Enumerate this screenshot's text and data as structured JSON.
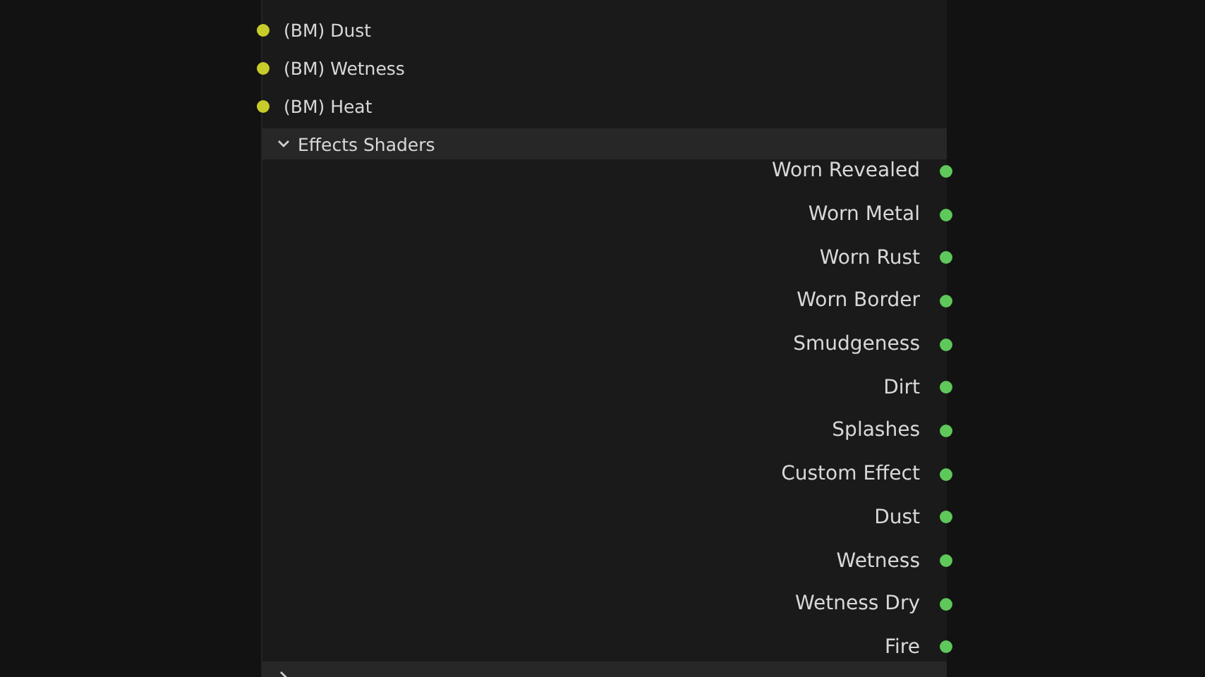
{
  "inputs": [
    {
      "label": "(BM) Dust"
    },
    {
      "label": "(BM) Wetness"
    },
    {
      "label": "(BM) Heat"
    }
  ],
  "panels": [
    {
      "title": "Effects Shaders",
      "expanded": true,
      "outputs": [
        {
          "label": "Worn Revealed"
        },
        {
          "label": "Worn Metal"
        },
        {
          "label": "Worn Rust"
        },
        {
          "label": "Worn Border"
        },
        {
          "label": "Smudgeness"
        },
        {
          "label": "Dirt"
        },
        {
          "label": "Splashes"
        },
        {
          "label": "Custom Effect"
        },
        {
          "label": "Dust"
        },
        {
          "label": "Wetness"
        },
        {
          "label": "Wetness Dry"
        },
        {
          "label": "Fire"
        }
      ]
    },
    {
      "expanded": false
    }
  ]
}
